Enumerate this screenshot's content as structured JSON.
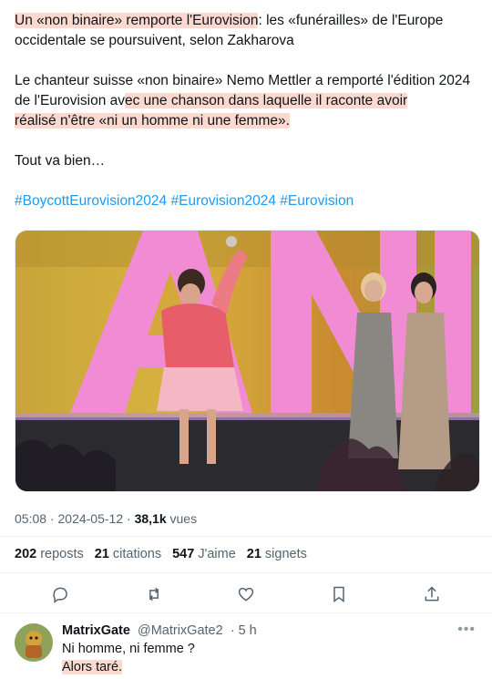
{
  "tweet": {
    "line1_highlight": "Un «non binaire» remporte l'Eurovision",
    "line1_rest": ": les «funérailles» de l'Europe occidentale se poursuivent, selon Zakharova",
    "para2_start": "Le chanteur suisse «non binaire» Nemo Mettler a remporté l'édition 2024 de l'Eurovision av",
    "para2_highlight_a": "ec une chanson dans laquelle il raconte avoir",
    "para2_highlight_b": "réalisé n'être «ni un homme ni une femme».",
    "para3": "Tout va bien…",
    "hashtags": [
      "#BoycottEurovision2024",
      "#Eurovision2024",
      "#Eurovision"
    ]
  },
  "meta": {
    "time": "05:08",
    "sep1": " · ",
    "date": "2024-05-12",
    "sep2": " · ",
    "views": "38,1k",
    "views_label": " vues"
  },
  "stats": [
    {
      "count": "202",
      "label": "reposts"
    },
    {
      "count": "21",
      "label": "citations"
    },
    {
      "count": "547",
      "label": "J'aime"
    },
    {
      "count": "21",
      "label": "signets"
    }
  ],
  "actions": {
    "icons": [
      "reply-icon",
      "repost-icon",
      "like-icon",
      "bookmark-icon",
      "share-icon"
    ]
  },
  "reply": {
    "name": "MatrixGate",
    "handle": "@MatrixGate2",
    "time": "· 5 h",
    "line1": "Ni homme, ni femme ?",
    "line2": "Alors taré."
  },
  "colors": {
    "highlight": "#fbd9cf",
    "link": "#1d9bf0",
    "secondary": "#536471"
  }
}
